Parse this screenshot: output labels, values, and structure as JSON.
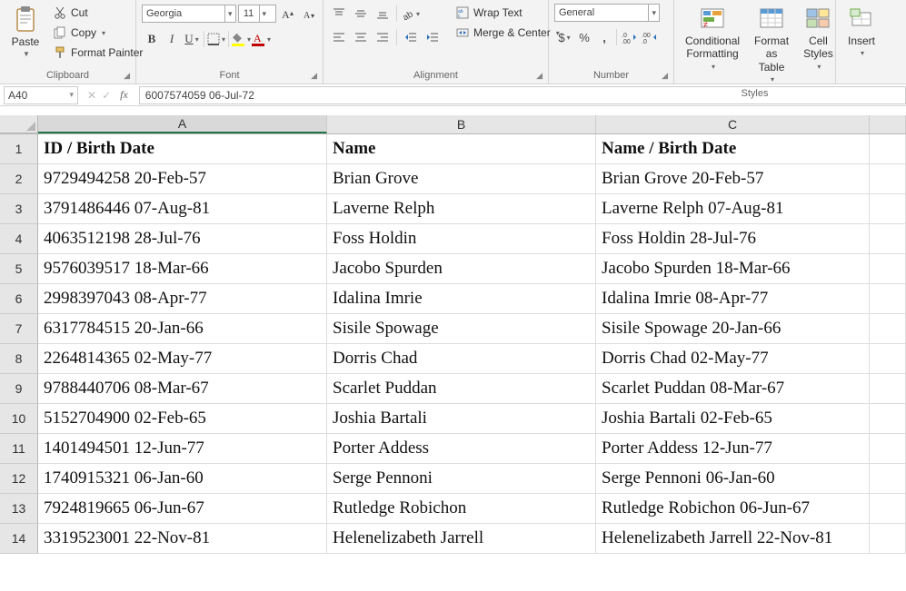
{
  "ribbon": {
    "clipboard": {
      "paste": "Paste",
      "cut": "Cut",
      "copy": "Copy",
      "format_painter": "Format Painter",
      "label": "Clipboard"
    },
    "font": {
      "name": "Georgia",
      "size": "11",
      "label": "Font"
    },
    "alignment": {
      "wrap": "Wrap Text",
      "merge": "Merge & Center",
      "label": "Alignment"
    },
    "number": {
      "format": "General",
      "label": "Number"
    },
    "styles": {
      "cond": "Conditional\nFormatting",
      "table": "Format as\nTable",
      "cell": "Cell\nStyles",
      "label": "Styles"
    },
    "cells": {
      "insert": "Insert"
    }
  },
  "formula_bar": {
    "cell_ref": "A40",
    "formula": "6007574059 06-Jul-72"
  },
  "columns": [
    "A",
    "B",
    "C"
  ],
  "col_widths": {
    "A": 318,
    "B": 296,
    "C": 301
  },
  "headers": {
    "A": "ID / Birth Date",
    "B": "Name",
    "C": "Name / Birth Date"
  },
  "rows": [
    {
      "n": 2,
      "A": "9729494258 20-Feb-57",
      "B": "Brian Grove",
      "C": "Brian Grove 20-Feb-57"
    },
    {
      "n": 3,
      "A": "3791486446 07-Aug-81",
      "B": "Laverne Relph",
      "C": "Laverne Relph 07-Aug-81"
    },
    {
      "n": 4,
      "A": "4063512198 28-Jul-76",
      "B": "Foss Holdin",
      "C": "Foss Holdin 28-Jul-76"
    },
    {
      "n": 5,
      "A": "9576039517 18-Mar-66",
      "B": "Jacobo Spurden",
      "C": "Jacobo Spurden 18-Mar-66"
    },
    {
      "n": 6,
      "A": "2998397043 08-Apr-77",
      "B": "Idalina Imrie",
      "C": "Idalina Imrie 08-Apr-77"
    },
    {
      "n": 7,
      "A": "6317784515 20-Jan-66",
      "B": "Sisile Spowage",
      "C": "Sisile Spowage 20-Jan-66"
    },
    {
      "n": 8,
      "A": "2264814365 02-May-77",
      "B": "Dorris Chad",
      "C": "Dorris Chad 02-May-77"
    },
    {
      "n": 9,
      "A": "9788440706 08-Mar-67",
      "B": "Scarlet Puddan",
      "C": "Scarlet Puddan 08-Mar-67"
    },
    {
      "n": 10,
      "A": "5152704900 02-Feb-65",
      "B": "Joshia Bartali",
      "C": "Joshia Bartali 02-Feb-65"
    },
    {
      "n": 11,
      "A": "1401494501 12-Jun-77",
      "B": "Porter Addess",
      "C": "Porter Addess 12-Jun-77"
    },
    {
      "n": 12,
      "A": "1740915321 06-Jan-60",
      "B": "Serge Pennoni",
      "C": "Serge Pennoni 06-Jan-60"
    },
    {
      "n": 13,
      "A": "7924819665 06-Jun-67",
      "B": "Rutledge Robichon",
      "C": "Rutledge Robichon 06-Jun-67"
    },
    {
      "n": 14,
      "A": "3319523001 22-Nov-81",
      "B": "Helenelizabeth Jarrell",
      "C": "Helenelizabeth Jarrell 22-Nov-81"
    }
  ]
}
